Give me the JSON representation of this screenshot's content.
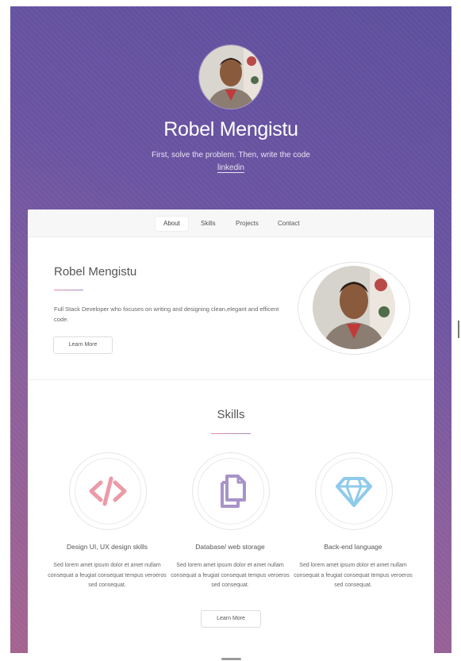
{
  "header": {
    "name": "Robel Mengistu",
    "tagline": "First, solve the problem. Then, write the code",
    "link_label": "linkedin"
  },
  "nav": {
    "items": [
      {
        "label": "About",
        "active": true
      },
      {
        "label": "Skills",
        "active": false
      },
      {
        "label": "Projects",
        "active": false
      },
      {
        "label": "Contact",
        "active": false
      }
    ]
  },
  "about": {
    "title": "Robel Mengistu",
    "description": "Full Stack Developer who focuses on writing and designing clean,elegant and efficent code.",
    "button_label": "Learn More"
  },
  "skills": {
    "title": "Skills",
    "items": [
      {
        "icon": "code-icon",
        "color": "#ec9aa8",
        "title": "Design UI, UX design skills",
        "description": "Sed lorem amet ipsum dolor et amet nullam consequat a feugiat consequat tempus veroeros sed consequat."
      },
      {
        "icon": "copy-files-icon",
        "color": "#a893c9",
        "title": "Database/ web storage",
        "description": "Sed lorem amet ipsum dolor et amet nullam consequat a feugiat consequat tempus veroeros sed consequat."
      },
      {
        "icon": "diamond-icon",
        "color": "#8fcbea",
        "title": "Back-end language",
        "description": "Sed lorem amet ipsum dolor et amet nullam consequat a feugiat consequat tempus veroeros sed consequat."
      }
    ],
    "button_label": "Learn More"
  },
  "colors": {
    "gradient_top": "#5d4f9c",
    "gradient_bottom": "#a5638f",
    "accent_pink": "#ec9aa8",
    "accent_purple": "#a893c9",
    "accent_blue": "#8fcbea"
  }
}
